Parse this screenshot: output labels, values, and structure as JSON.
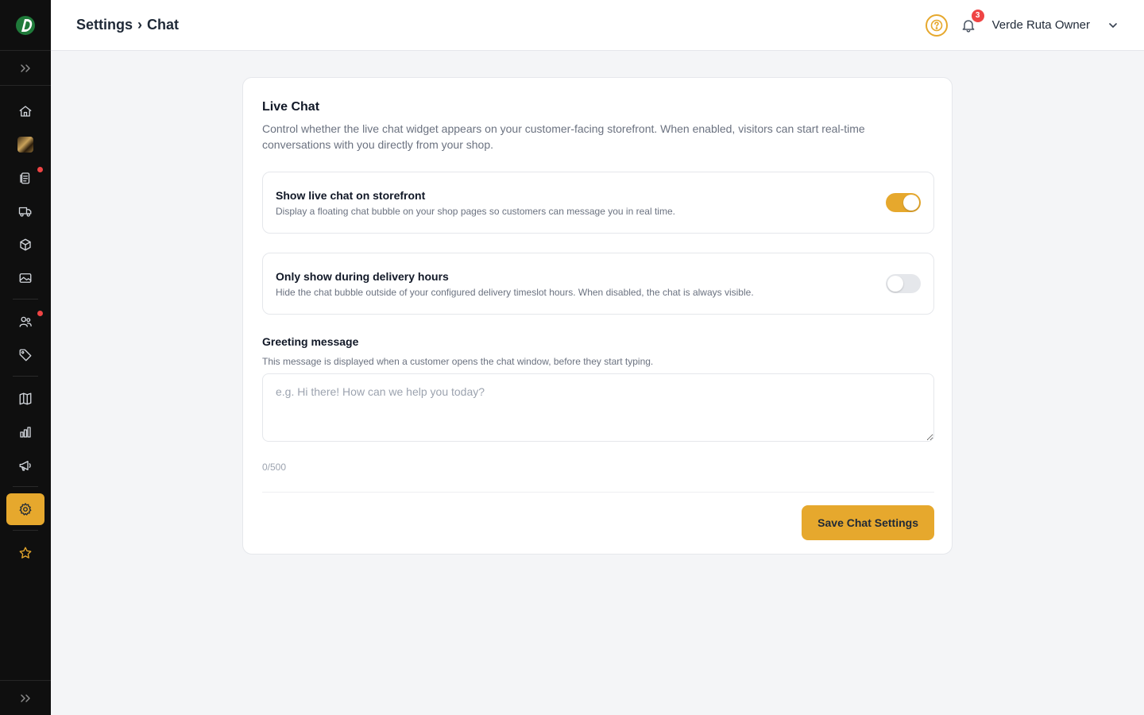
{
  "header": {
    "breadcrumb_parent": "Settings",
    "breadcrumb_separator": "›",
    "breadcrumb_current": "Chat",
    "notification_count": "3",
    "user_name": "Verde Ruta Owner"
  },
  "sidebar": {
    "items": [
      {
        "icon": "home-icon"
      },
      {
        "icon": "store-avatar"
      },
      {
        "icon": "orders-icon",
        "has_alert": true
      },
      {
        "icon": "truck-icon"
      },
      {
        "icon": "box-icon"
      },
      {
        "icon": "image-icon"
      },
      {
        "icon": "users-icon",
        "has_alert": true
      },
      {
        "icon": "tag-icon"
      },
      {
        "icon": "book-icon"
      },
      {
        "icon": "chart-icon"
      },
      {
        "icon": "megaphone-icon"
      },
      {
        "icon": "gear-icon",
        "active": true
      },
      {
        "icon": "star-icon"
      }
    ]
  },
  "card": {
    "title": "Live Chat",
    "description": "Control whether the live chat widget appears on your customer-facing storefront. When enabled, visitors can start real-time conversations with you directly from your shop.",
    "settings": [
      {
        "title": "Show live chat on storefront",
        "subtitle": "Display a floating chat bubble on your shop pages so customers can message you in real time.",
        "enabled": true
      },
      {
        "title": "Only show during delivery hours",
        "subtitle": "Hide the chat bubble outside of your configured delivery timeslot hours. When disabled, the chat is always visible.",
        "enabled": false
      }
    ],
    "greeting": {
      "label": "Greeting message",
      "help": "This message is displayed when a customer opens the chat window, before they start typing.",
      "placeholder": "e.g. Hi there! How can we help you today?",
      "value": "",
      "counter": "0/500"
    },
    "save_label": "Save Chat Settings"
  },
  "colors": {
    "accent": "#e6a82d",
    "sidebar_bg": "#0f0f0f",
    "alert": "#ef4444"
  }
}
